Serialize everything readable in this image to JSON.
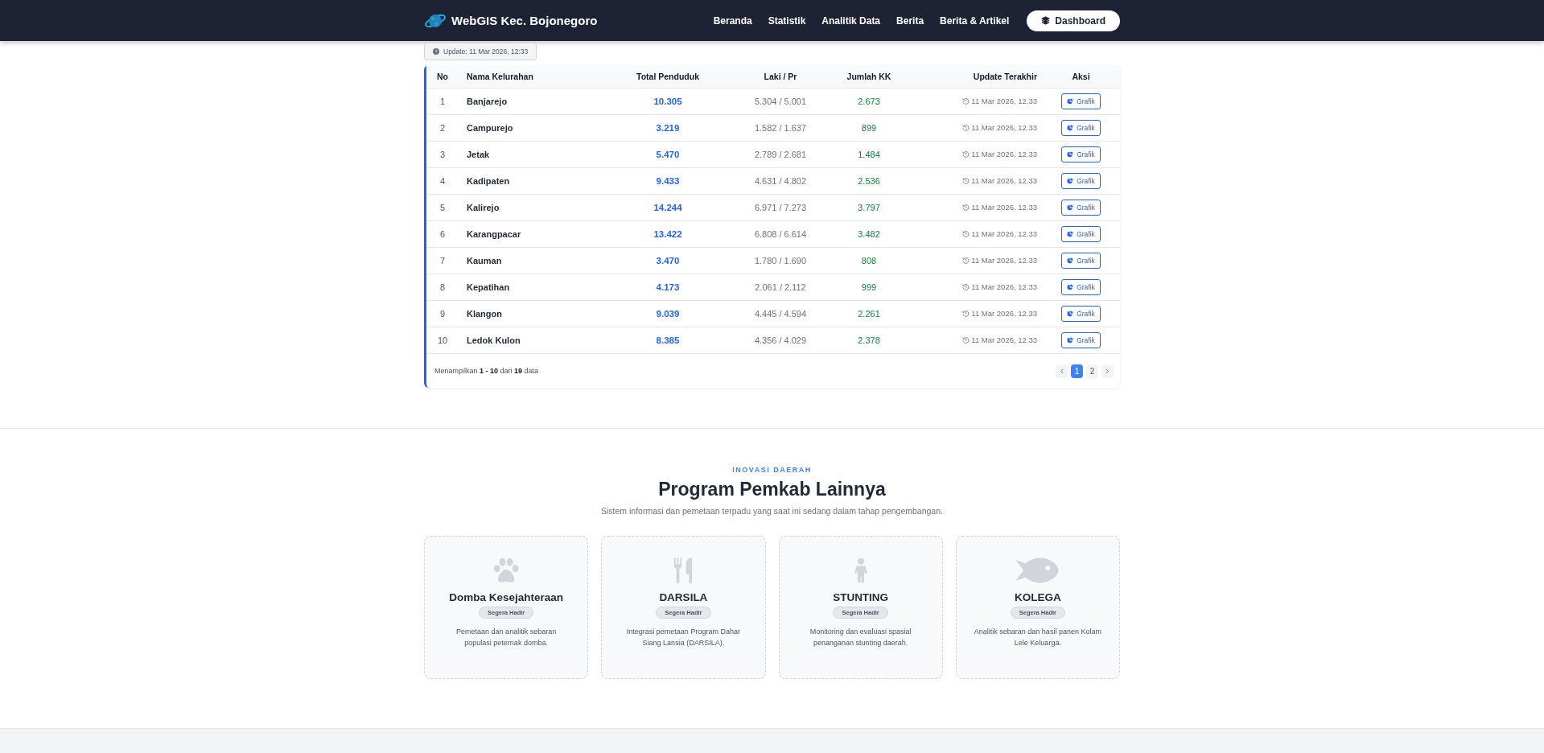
{
  "navbar": {
    "brand": "WebGIS Kec. Bojonegoro",
    "links": [
      "Beranda",
      "Statistik",
      "Analitik Data",
      "Berita",
      "Berita & Artikel"
    ],
    "dashboard_button": "Dashboard"
  },
  "update_badge": "Update: 11 Mar 2026, 12:33",
  "table": {
    "columns": [
      "No",
      "Nama Kelurahan",
      "Total Penduduk",
      "Laki / Pr",
      "Jumlah KK",
      "Update Terakhir",
      "Aksi"
    ],
    "rows": [
      {
        "no": "1",
        "name": "Banjarejo",
        "total": "10.305",
        "gender": "5.304 / 5.001",
        "kk": "2.673",
        "updated": "11 Mar 2026, 12.33",
        "action": "Grafik"
      },
      {
        "no": "2",
        "name": "Campurejo",
        "total": "3.219",
        "gender": "1.582 / 1.637",
        "kk": "899",
        "updated": "11 Mar 2026, 12.33",
        "action": "Grafik"
      },
      {
        "no": "3",
        "name": "Jetak",
        "total": "5.470",
        "gender": "2.789 / 2.681",
        "kk": "1.484",
        "updated": "11 Mar 2026, 12.33",
        "action": "Grafik"
      },
      {
        "no": "4",
        "name": "Kadipaten",
        "total": "9.433",
        "gender": "4.631 / 4.802",
        "kk": "2.536",
        "updated": "11 Mar 2026, 12.33",
        "action": "Grafik"
      },
      {
        "no": "5",
        "name": "Kalirejo",
        "total": "14.244",
        "gender": "6.971 / 7.273",
        "kk": "3.797",
        "updated": "11 Mar 2026, 12.33",
        "action": "Grafik"
      },
      {
        "no": "6",
        "name": "Karangpacar",
        "total": "13.422",
        "gender": "6.808 / 6.614",
        "kk": "3.482",
        "updated": "11 Mar 2026, 12.33",
        "action": "Grafik"
      },
      {
        "no": "7",
        "name": "Kauman",
        "total": "3.470",
        "gender": "1.780 / 1.690",
        "kk": "808",
        "updated": "11 Mar 2026, 12.33",
        "action": "Grafik"
      },
      {
        "no": "8",
        "name": "Kepatihan",
        "total": "4.173",
        "gender": "2.061 / 2.112",
        "kk": "999",
        "updated": "11 Mar 2026, 12.33",
        "action": "Grafik"
      },
      {
        "no": "9",
        "name": "Klangon",
        "total": "9.039",
        "gender": "4.445 / 4.594",
        "kk": "2.261",
        "updated": "11 Mar 2026, 12.33",
        "action": "Grafik"
      },
      {
        "no": "10",
        "name": "Ledok Kulon",
        "total": "8.385",
        "gender": "4.356 / 4.029",
        "kk": "2.378",
        "updated": "11 Mar 2026, 12.33",
        "action": "Grafik"
      }
    ],
    "summary": "Menampilkan **1 - 10** dari **19** data",
    "pages": [
      {
        "label": "1",
        "selected": true
      },
      {
        "label": "2",
        "selected": false
      }
    ]
  },
  "section": {
    "eyebrow": "INOVASI DAERAH",
    "title": "Program Pemkab Lainnya",
    "subtitle": "Sistem informasi dan pemetaan terpadu yang saat ini sedang dalam tahap pengembangan.",
    "programs": [
      {
        "kind": "paw",
        "title": "Domba Kesejahteraan",
        "badge": "Segera Hadir",
        "description": "Pemetaan dan analitik sebaran populasi peternak domba."
      },
      {
        "kind": "utensils",
        "title": "DARSILA",
        "badge": "Segera Hadir",
        "description": "Integrasi pemetaan Program Dahar Siang Lansia (DARSILA)."
      },
      {
        "kind": "child",
        "title": "STUNTING",
        "badge": "Segera Hadir",
        "description": "Monitoring dan evaluasi spasial penanganan stunting daerah."
      },
      {
        "kind": "fish",
        "title": "KOLEGA",
        "badge": "Segera Hadir",
        "description": "Analitik sebaran dan hasil panen Kolam Lele Keluarga."
      }
    ]
  }
}
